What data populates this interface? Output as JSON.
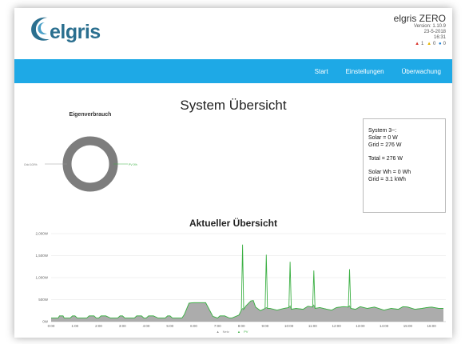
{
  "header": {
    "logo_text": "elgris",
    "product": "elgris ZERO",
    "version": "Version: 1.10.9",
    "date": "23-5-2018",
    "time": "16:31",
    "alerts": {
      "red": "1",
      "yellow": "0",
      "blue": "0"
    }
  },
  "nav": [
    "Start",
    "Einstellungen",
    "Überwachung"
  ],
  "page_title": "System Übersicht",
  "donut": {
    "title": "Eigenverbrauch",
    "left_label": "Grid 100%",
    "right_label": "PV 0%",
    "grid_percent": 100,
    "pv_percent": 0
  },
  "summary": {
    "line1": "System 3~:",
    "line2": "Solar = 0 W",
    "line3": "Grid = 276 W",
    "line4": "Total = 276 W",
    "line5": "Solar Wh = 0 Wh",
    "line6": "Grid = 3.1 kWh"
  },
  "colors": {
    "accent": "#1ea9e6",
    "netz": "#9e9e9e",
    "pv": "#3cb044"
  },
  "chart_data": {
    "type": "area",
    "title": "Aktueller Übersicht",
    "yticks": [
      "0W",
      "500W",
      "1,000W",
      "1,500W",
      "2,000W"
    ],
    "ylim": [
      0,
      2000
    ],
    "xticks": [
      "0:00",
      "1:00",
      "2:00",
      "3:00",
      "4:00",
      "5:00",
      "6:00",
      "7:00",
      "8:00",
      "9:00",
      "10:00",
      "11:00",
      "12:00",
      "13:00",
      "14:00",
      "15:00",
      "16:00"
    ],
    "x_hours": [
      0,
      0.3,
      0.35,
      0.5,
      0.55,
      0.8,
      0.9,
      1.0,
      1.1,
      1.3,
      1.5,
      1.6,
      1.8,
      1.9,
      2.0,
      2.1,
      2.3,
      2.5,
      2.6,
      2.8,
      2.9,
      3.0,
      3.1,
      3.3,
      3.5,
      3.6,
      3.8,
      3.9,
      4.0,
      4.1,
      4.3,
      4.5,
      4.6,
      4.8,
      4.9,
      5.0,
      5.1,
      5.3,
      5.5,
      5.6,
      5.8,
      6.0,
      6.5,
      6.8,
      7.0,
      7.1,
      7.3,
      7.5,
      7.6,
      7.9,
      8.0,
      8.05,
      8.1,
      8.2,
      8.4,
      8.5,
      8.6,
      8.8,
      9.0,
      9.05,
      9.1,
      9.2,
      9.5,
      9.8,
      10.0,
      10.05,
      10.1,
      10.3,
      10.6,
      10.8,
      11.0,
      11.05,
      11.1,
      11.3,
      11.6,
      11.8,
      12.0,
      12.3,
      12.5,
      12.55,
      12.6,
      12.8,
      13.0,
      13.3,
      13.6,
      14.0,
      14.3,
      14.6,
      14.8,
      15.0,
      15.3,
      15.6,
      15.8,
      16.0,
      16.3,
      16.5
    ],
    "series": [
      {
        "name": "Netz",
        "values": [
          80,
          80,
          130,
          130,
          80,
          80,
          130,
          130,
          80,
          80,
          80,
          130,
          130,
          80,
          80,
          130,
          130,
          80,
          80,
          80,
          130,
          130,
          80,
          80,
          80,
          130,
          130,
          80,
          80,
          130,
          130,
          80,
          80,
          80,
          130,
          130,
          80,
          80,
          80,
          160,
          420,
          430,
          430,
          120,
          80,
          130,
          130,
          80,
          80,
          150,
          260,
          300,
          280,
          360,
          470,
          480,
          330,
          250,
          300,
          320,
          300,
          300,
          260,
          300,
          320,
          360,
          280,
          300,
          280,
          350,
          330,
          380,
          300,
          320,
          280,
          260,
          320,
          340,
          330,
          360,
          300,
          280,
          340,
          300,
          330,
          260,
          300,
          280,
          340,
          330,
          280,
          300,
          320,
          330,
          300,
          300
        ]
      },
      {
        "name": "PV",
        "values": [
          0,
          0,
          0,
          0,
          0,
          0,
          0,
          0,
          0,
          0,
          0,
          0,
          0,
          0,
          0,
          0,
          0,
          0,
          0,
          0,
          0,
          0,
          0,
          0,
          0,
          0,
          0,
          0,
          0,
          0,
          0,
          0,
          0,
          0,
          0,
          0,
          0,
          0,
          0,
          0,
          0,
          0,
          0,
          0,
          0,
          0,
          0,
          0,
          0,
          0,
          0,
          1450,
          0,
          0,
          0,
          0,
          0,
          0,
          0,
          1200,
          0,
          0,
          0,
          0,
          0,
          1000,
          0,
          0,
          0,
          0,
          0,
          780,
          0,
          0,
          0,
          0,
          0,
          0,
          0,
          830,
          0,
          0,
          0,
          0,
          0,
          0,
          0,
          0,
          0,
          0,
          0,
          0,
          0,
          0,
          0,
          0
        ]
      }
    ],
    "legend": [
      "Netz",
      "PV"
    ]
  }
}
